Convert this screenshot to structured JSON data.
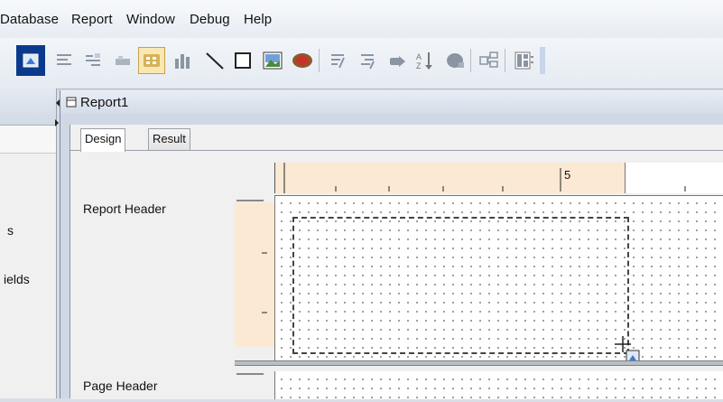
{
  "menu": {
    "items": [
      "Database",
      "Report",
      "Window",
      "Debug",
      "Help"
    ]
  },
  "toolbar": {
    "icons": [
      "report-object-icon",
      "text-align-icon",
      "text-rows-icon",
      "tab-icon",
      "barcode-icon",
      "chart-icon",
      "line-icon",
      "rectangle-icon",
      "picture-icon",
      "ole-icon",
      "memo-icon",
      "memo-rich-icon",
      "arrow-right-icon",
      "sort-icon",
      "database-icon",
      "dataset-icon",
      "page-icon"
    ]
  },
  "left_panel": {
    "items": [
      "s",
      "ields"
    ]
  },
  "report_window": {
    "title": "Report1",
    "tabs": [
      "Design",
      "Result"
    ],
    "active_tab": "Design",
    "ruler_label": "5",
    "bands": [
      "Report Header",
      "Page Header"
    ]
  },
  "colors": {
    "accent": "#0b3a8c",
    "ruler": "#fbe9d3"
  }
}
